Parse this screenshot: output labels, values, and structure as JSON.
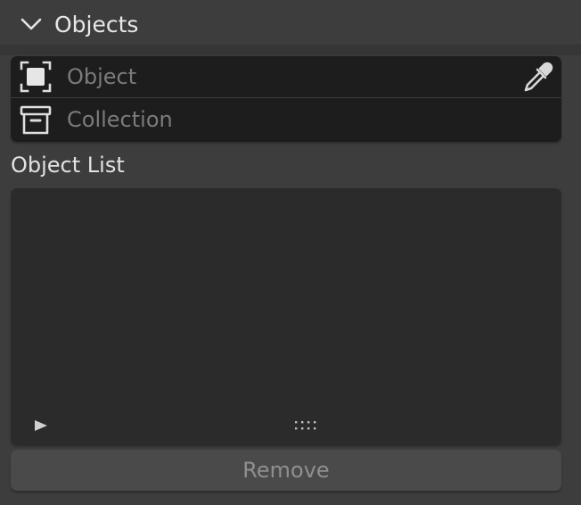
{
  "panel": {
    "title": "Objects"
  },
  "selector": {
    "object_placeholder": "Object",
    "collection_placeholder": "Collection"
  },
  "list": {
    "label": "Object List"
  },
  "actions": {
    "remove_label": "Remove"
  },
  "icons": {
    "collapse": "chevron-down-icon",
    "object": "object-icon",
    "collection": "collection-icon",
    "eyedropper": "eyedropper-icon",
    "expand": "play-triangle-icon",
    "grip": "resize-grip-icon"
  },
  "colors": {
    "panel_bg": "#3d3d3d",
    "field_bg": "#1d1d1d",
    "list_bg": "#2b2b2b",
    "button_bg": "#4a4a4a",
    "text_primary": "#e8e8e8",
    "text_placeholder": "#7b7b7b",
    "text_disabled": "#8f8f8f"
  }
}
